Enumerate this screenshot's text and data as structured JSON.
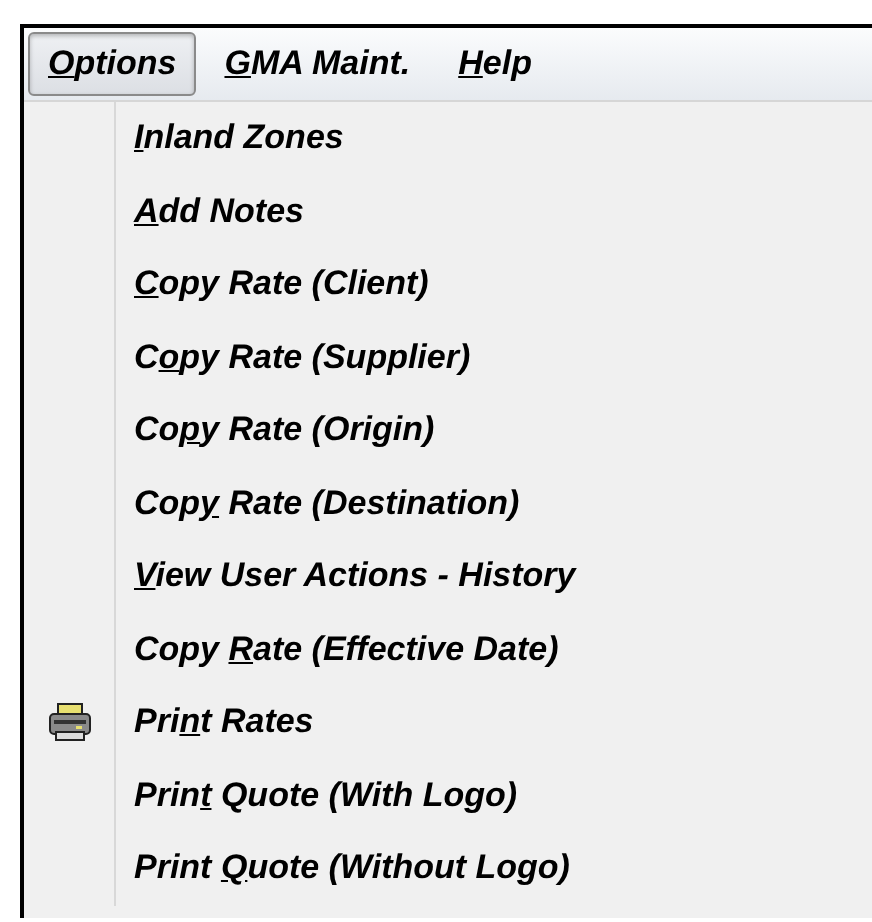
{
  "menu_bar": [
    {
      "access_key": "O",
      "text_after": "ptions",
      "selected": true
    },
    {
      "access_key": "G",
      "text_after": "MA Maint.",
      "selected": false
    },
    {
      "access_key": "H",
      "text_after": "elp",
      "selected": false
    }
  ],
  "menu_items": [
    {
      "access_key": "I",
      "text_after": "nland Zones",
      "has_icon": false
    },
    {
      "access_key": "A",
      "text_after": "dd Notes",
      "has_icon": false
    },
    {
      "access_key": "C",
      "text_after": "opy Rate (Client)",
      "has_icon": false
    },
    {
      "text_before": "C",
      "access_key": "o",
      "text_after": "py Rate (Supplier)",
      "has_icon": false
    },
    {
      "text_before": "Co",
      "access_key": "p",
      "text_after": "y Rate (Origin)",
      "has_icon": false
    },
    {
      "text_before": "Cop",
      "access_key": "y",
      "text_after": " Rate (Destination)",
      "has_icon": false
    },
    {
      "access_key": "V",
      "text_after": "iew User Actions - History",
      "has_icon": false
    },
    {
      "text_before": "Copy ",
      "access_key": "R",
      "text_after": "ate (Effective Date)",
      "has_icon": false
    },
    {
      "text_before": "Pri",
      "access_key": "n",
      "text_after": "t Rates",
      "has_icon": true
    },
    {
      "text_before": "Prin",
      "access_key": "t",
      "text_after": " Quote (With Logo)",
      "has_icon": false
    },
    {
      "text_before": "Print ",
      "access_key": "Q",
      "text_after": "uote (Without Logo)",
      "has_icon": false
    }
  ]
}
